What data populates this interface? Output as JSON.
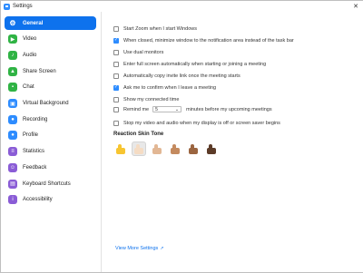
{
  "window": {
    "title": "Settings"
  },
  "sidebar": {
    "items": [
      {
        "label": "General",
        "icon": "gear-icon",
        "color": "#ffffff",
        "active": true
      },
      {
        "label": "Video",
        "icon": "video-camera-icon",
        "color": "#2fb344",
        "active": false
      },
      {
        "label": "Audio",
        "icon": "headphones-icon",
        "color": "#2fb344",
        "active": false
      },
      {
        "label": "Share Screen",
        "icon": "share-screen-icon",
        "color": "#2fb344",
        "active": false
      },
      {
        "label": "Chat",
        "icon": "chat-bubble-icon",
        "color": "#2fb344",
        "active": false
      },
      {
        "label": "Virtual Background",
        "icon": "person-background-icon",
        "color": "#2d8cff",
        "active": false
      },
      {
        "label": "Recording",
        "icon": "record-icon",
        "color": "#2d8cff",
        "active": false
      },
      {
        "label": "Profile",
        "icon": "person-icon",
        "color": "#2d8cff",
        "active": false
      },
      {
        "label": "Statistics",
        "icon": "statistics-icon",
        "color": "#8a5cd6",
        "active": false
      },
      {
        "label": "Feedback",
        "icon": "feedback-icon",
        "color": "#8a5cd6",
        "active": false
      },
      {
        "label": "Keyboard Shortcuts",
        "icon": "keyboard-icon",
        "color": "#8a5cd6",
        "active": false
      },
      {
        "label": "Accessibility",
        "icon": "accessibility-icon",
        "color": "#8a5cd6",
        "active": false
      }
    ]
  },
  "options": [
    {
      "label": "Start Zoom when I start Windows",
      "checked": false
    },
    {
      "label": "When closed, minimize window to the notification area instead of the task bar",
      "checked": true
    },
    {
      "label": "Use dual monitors",
      "checked": false
    },
    {
      "label": "Enter full screen automatically when starting or joining a meeting",
      "checked": false
    },
    {
      "label": "Automatically copy invite link once the meeting starts",
      "checked": false
    },
    {
      "label": "Ask me to confirm when I leave a meeting",
      "checked": true
    },
    {
      "label": "Show my connected time",
      "checked": false
    },
    {
      "label_before": "Remind me",
      "value": "5",
      "label_after": "minutes before my upcoming meetings",
      "checked": false
    },
    {
      "label": "Stop my video and audio when my display is off or screen saver begins",
      "checked": false
    }
  ],
  "skin_tone": {
    "title": "Reaction Skin Tone",
    "selected_index": 1,
    "tones": [
      {
        "name": "default",
        "color": "#f7c531"
      },
      {
        "name": "light",
        "color": "#f5dcc4"
      },
      {
        "name": "medium-light",
        "color": "#e2b794"
      },
      {
        "name": "medium",
        "color": "#c48a5f"
      },
      {
        "name": "medium-dark",
        "color": "#9b6540"
      },
      {
        "name": "dark",
        "color": "#5c3b28"
      }
    ]
  },
  "footer": {
    "link": "View More Settings"
  }
}
